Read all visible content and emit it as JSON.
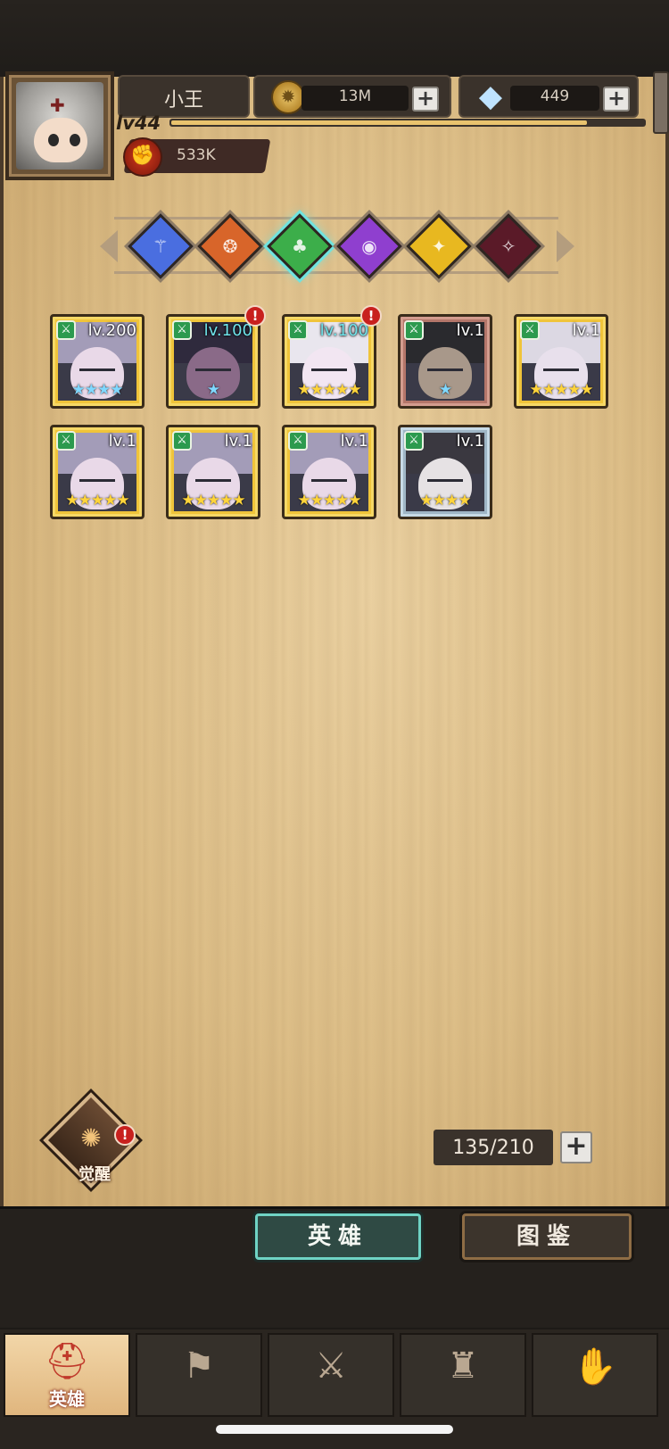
{
  "player": {
    "name": "小王",
    "level_label": "lv44",
    "xp_fraction": 0.88,
    "power": "533K"
  },
  "resources": {
    "gold": {
      "icon": "gold-coin-icon",
      "value": "13M"
    },
    "gems": {
      "icon": "diamond-icon",
      "value": "449"
    }
  },
  "factions": [
    {
      "icon": "blue-faction-icon",
      "color": "#4a6ee0",
      "selected": false
    },
    {
      "icon": "orange-faction-icon",
      "color": "#d8652a",
      "selected": false
    },
    {
      "icon": "green-clover-faction-icon",
      "color": "#3cae4a",
      "selected": true
    },
    {
      "icon": "purple-faction-icon",
      "color": "#8f3fcf",
      "selected": false
    },
    {
      "icon": "yellow-faction-icon",
      "color": "#e8b820",
      "selected": false
    },
    {
      "icon": "dark-red-faction-icon",
      "color": "#5a1a28",
      "selected": false
    }
  ],
  "heroes": [
    {
      "level": "lv.200",
      "stars": "★★★★",
      "frame": "gold",
      "alert": false
    },
    {
      "level": "lv.100",
      "stars": "★",
      "frame": "gold",
      "alert": true
    },
    {
      "level": "lv.100",
      "stars": "★★★★★",
      "frame": "gold",
      "alert": true
    },
    {
      "level": "lv.1",
      "stars": "★",
      "frame": "red",
      "alert": false
    },
    {
      "level": "lv.1",
      "stars": "★★★★★",
      "frame": "gold",
      "alert": false
    },
    {
      "level": "lv.1",
      "stars": "★★★★★",
      "frame": "gold",
      "alert": false
    },
    {
      "level": "lv.1",
      "stars": "★★★★★",
      "frame": "gold",
      "alert": false
    },
    {
      "level": "lv.1",
      "stars": "★★★★★",
      "frame": "gold",
      "alert": false
    },
    {
      "level": "lv.1",
      "stars": "★★★★",
      "frame": "blue",
      "alert": false
    }
  ],
  "awaken": {
    "label": "觉醒",
    "alert": true
  },
  "capacity": "135/210",
  "tabs": {
    "heroes": "英雄",
    "codex": "图鉴"
  },
  "nav": [
    {
      "icon": "knight-helmet-icon",
      "label": "英雄",
      "active": true
    },
    {
      "icon": "flag-wheel-icon",
      "label": "",
      "active": false
    },
    {
      "icon": "crossed-swords-icon",
      "label": "",
      "active": false
    },
    {
      "icon": "castle-tower-icon",
      "label": "",
      "active": false
    },
    {
      "icon": "handshake-shield-icon",
      "label": "",
      "active": false
    }
  ]
}
